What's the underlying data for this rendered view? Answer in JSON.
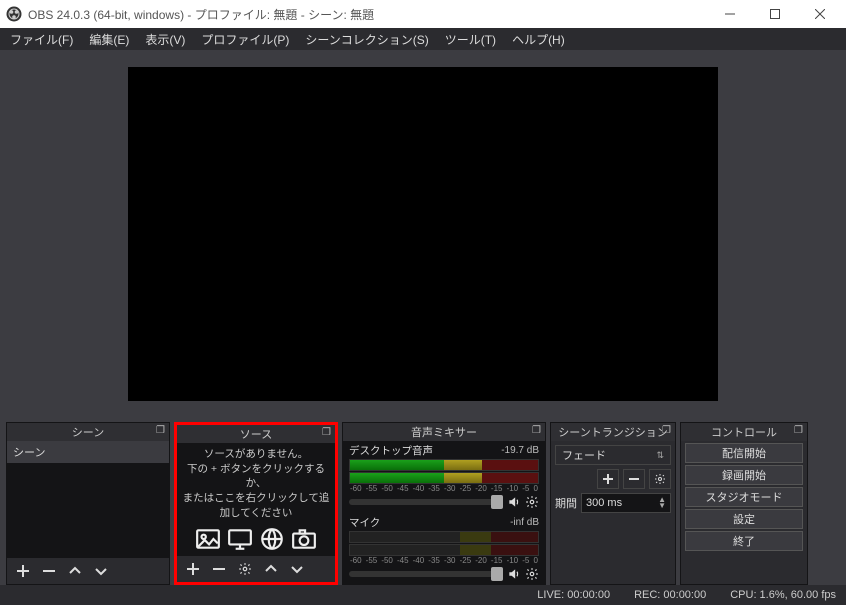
{
  "window": {
    "title": "OBS 24.0.3 (64-bit, windows) - プロファイル: 無題 - シーン: 無題"
  },
  "menu": {
    "file": "ファイル(F)",
    "edit": "編集(E)",
    "view": "表示(V)",
    "profile": "プロファイル(P)",
    "scene_collection": "シーンコレクション(S)",
    "tools": "ツール(T)",
    "help": "ヘルプ(H)"
  },
  "docks": {
    "scenes": {
      "title": "シーン",
      "items": [
        "シーン"
      ]
    },
    "sources": {
      "title": "ソース",
      "empty_line1": "ソースがありません。",
      "empty_line2": "下の + ボタンをクリックするか、",
      "empty_line3": "またはここを右クリックして追加してください"
    },
    "mixer": {
      "title": "音声ミキサー",
      "channels": [
        {
          "name": "デスクトップ音声",
          "db": "-19.7 dB"
        },
        {
          "name": "マイク",
          "db": "-inf dB"
        }
      ],
      "scale": [
        "-60",
        "-55",
        "-50",
        "-45",
        "-40",
        "-35",
        "-30",
        "-25",
        "-20",
        "-15",
        "-10",
        "-5",
        "0"
      ]
    },
    "transition": {
      "title": "シーントランジション",
      "selected": "フェード",
      "duration_label": "期間",
      "duration_value": "300 ms"
    },
    "controls": {
      "title": "コントロール",
      "buttons": [
        "配信開始",
        "録画開始",
        "スタジオモード",
        "設定",
        "終了"
      ]
    }
  },
  "status": {
    "live": "LIVE: 00:00:00",
    "rec": "REC: 00:00:00",
    "cpu": "CPU: 1.6%, 60.00 fps"
  }
}
